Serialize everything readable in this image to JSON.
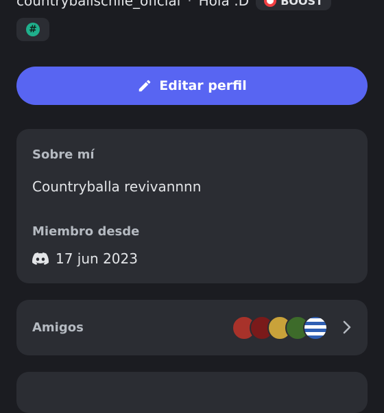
{
  "profile": {
    "username": "countryballschile_oficial",
    "status": "Hola :D",
    "badge_label": "BOOST"
  },
  "actions": {
    "edit_profile": "Editar perfil"
  },
  "about": {
    "about_label": "Sobre mí",
    "about_text": "Countryballa revivannnn",
    "member_since_label": "Miembro desde",
    "member_since_date": "17 jun 2023"
  },
  "friends": {
    "label": "Amigos",
    "avatar_colors": [
      "#a8322a",
      "#7a1a1a",
      "#c9a23a",
      "#3d6b2a",
      "#2f5fb3"
    ]
  },
  "colors": {
    "accent": "#5865f2",
    "card": "#2b2d33",
    "background": "#1b1c21",
    "hash_badge": "#1fb08c"
  }
}
